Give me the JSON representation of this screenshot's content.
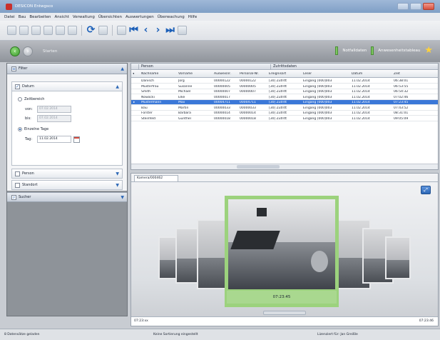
{
  "window": {
    "title": "DESICON Entwgsco"
  },
  "menu": [
    "Datei",
    "Bau",
    "Bearbeiten",
    "Ansicht",
    "Verwaltung",
    "Übersichten",
    "Auswertungen",
    "Überwachung",
    "Hilfe"
  ],
  "navbar": {
    "start_label": "Starten",
    "notfall_label": "Notfalldaten",
    "anwesenheit_label": "Anwesenheitstableau"
  },
  "sidebar": {
    "filter_title": "Filter",
    "datum_label": "Datum",
    "zeitbereich_label": "Zeitbereich",
    "von_label": "von:",
    "von_value": "07.02.2014",
    "bis_label": "bis:",
    "bis_value": "07.02.2014",
    "einzelne_tage_label": "Einzelne Tage",
    "tag_label": "Tag:",
    "tag_value": "11.02.2014",
    "person_label": "Person",
    "standort_label": "Standort",
    "sucher_label": "Sucher"
  },
  "table": {
    "group_headers": [
      "Person",
      "Zutrittsdaten"
    ],
    "columns": [
      "Nachname",
      "Vorname",
      "Ausweisnr.",
      "Personal-Nr.",
      "Ereignisart",
      "Leser",
      "Datum",
      "Zeit"
    ],
    "rows": [
      [
        "Danisch",
        "Jörg",
        "00000122",
        "00000122",
        "[30] Zutritt",
        "Eingang [000]003",
        "11.02.2014",
        "06:38:01"
      ],
      [
        "Musterfrau",
        "Susanne",
        "00000005",
        "00000005",
        "[30] Zutritt",
        "Eingang [000]003",
        "11.02.2014",
        "06:53:55"
      ],
      [
        "Smith",
        "Michael",
        "00000007",
        "00000007",
        "[30] Zutritt",
        "Eingang [000]003",
        "11.02.2014",
        "06:54:32"
      ],
      [
        "Nowacki",
        "Elke",
        "00000017",
        "",
        "[30] Zutritt",
        "Eingang [000]003",
        "11.02.2014",
        "07:02:46"
      ],
      [
        "Mustermann",
        "Max",
        "00004711",
        "00004711",
        "[30] Zutritt",
        "Eingang [000]003",
        "11.02.2014",
        "07:23:45"
      ],
      [
        "Bau",
        "Martin",
        "00000033",
        "00000033",
        "[30] Zutritt",
        "Eingang [000]003",
        "11.02.2014",
        "07:43:52"
      ],
      [
        "Förster",
        "Barbara",
        "00000014",
        "00000014",
        "[30] Zutritt",
        "Eingang [000]003",
        "11.02.2014",
        "08:31:01"
      ],
      [
        "Steinfeld",
        "Günther",
        "00000018",
        "00000018",
        "[30] Zutritt",
        "Eingang [000]003",
        "11.02.2014",
        "09:05:09"
      ]
    ],
    "selected_index": 4
  },
  "camera": {
    "tab_label": "Kamera/000462",
    "timestamp": "07:23:45",
    "timeline_start": "07:23:xx",
    "timeline_end": "07:23:46"
  },
  "status": {
    "left": "8 Datensätze geladen",
    "mid": "Keine Sortierung eingestellt",
    "right": "Lizenziert für: Jan Greißle"
  }
}
